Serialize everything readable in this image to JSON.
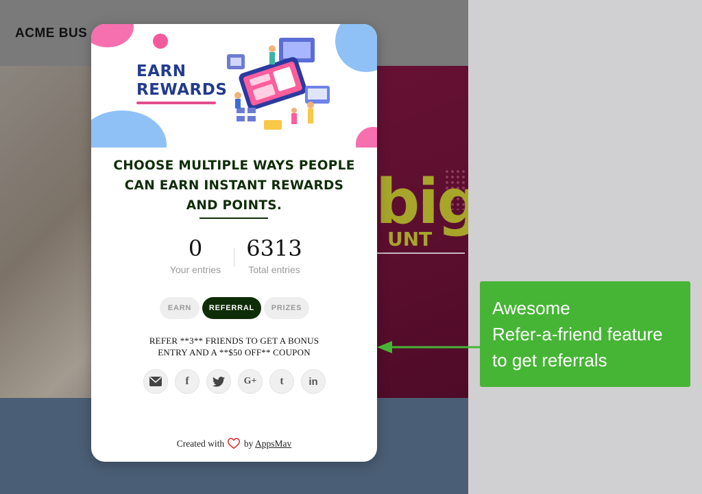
{
  "background_site": {
    "logo": "ACME BUS",
    "hero_big_text": "big",
    "hero_sub_text": "UNT"
  },
  "popup": {
    "banner": {
      "title_line1": "EARN",
      "title_line2": "REWARDS"
    },
    "headline_line1": "CHOOSE MULTIPLE WAYS PEOPLE",
    "headline_line2": "CAN EARN INSTANT REWARDS",
    "headline_line3": "AND POINTS.",
    "stats": {
      "your_entries_value": "0",
      "your_entries_label": "Your entries",
      "total_entries_value": "6313",
      "total_entries_label": "Total entries"
    },
    "tabs": [
      {
        "label": "EARN",
        "active": false
      },
      {
        "label": "REFERRAL",
        "active": true
      },
      {
        "label": "PRIZES",
        "active": false
      }
    ],
    "refer_text_line1": "REFER **3** FRIENDS TO GET A BONUS",
    "refer_text_line2": "ENTRY AND A **$50 OFF** COUPON",
    "share_buttons": [
      {
        "icon": "email-icon",
        "glyph": "✉"
      },
      {
        "icon": "facebook-icon",
        "glyph": "f"
      },
      {
        "icon": "twitter-icon",
        "glyph": "🐦"
      },
      {
        "icon": "google-plus-icon",
        "glyph": "G+"
      },
      {
        "icon": "tumblr-icon",
        "glyph": "t"
      },
      {
        "icon": "linkedin-icon",
        "glyph": "in"
      }
    ],
    "footer": {
      "created_with": "Created with",
      "by": "by",
      "brand": "AppsMav"
    }
  },
  "annotation": {
    "line1": "Awesome",
    "line2": "Refer-a-friend feature",
    "line3": "to get referrals"
  },
  "colors": {
    "accent_dark_green": "#0f2d08",
    "annotation_green": "#46b535",
    "banner_pink": "#f66fae",
    "banner_blue": "#8fc1f7",
    "title_blue": "#233b8e"
  }
}
